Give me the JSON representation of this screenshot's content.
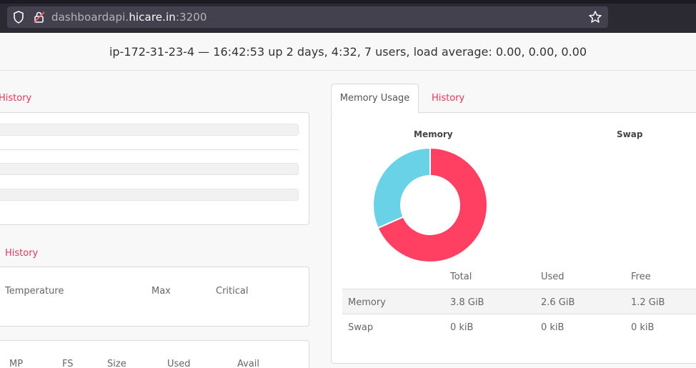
{
  "browser": {
    "url_host_prefix": "dashboardapi.",
    "url_host_main": "hicare.in",
    "url_port": ":3200"
  },
  "header": {
    "status_line": "ip-172-31-23-4 — 16:42:53 up 2 days, 4:32, 7 users, load average: 0.00, 0.00, 0.00"
  },
  "left": {
    "history_tab_1": "History",
    "history_tab_2": "History",
    "sensors_headers": [
      "Temperature",
      "Max",
      "Critical"
    ],
    "disk_headers": [
      "MP",
      "FS",
      "Size",
      "Used",
      "Avail"
    ]
  },
  "memory": {
    "tabs": [
      "Memory Usage",
      "History"
    ],
    "memory_chart_title": "Memory",
    "swap_chart_title": "Swap",
    "table_headers": [
      "",
      "Total",
      "Used",
      "Free"
    ],
    "rows": [
      {
        "label": "Memory",
        "total": "3.8 GiB",
        "used": "2.6 GiB",
        "free": "1.2 GiB"
      },
      {
        "label": "Swap",
        "total": "0 kiB",
        "used": "0 kiB",
        "free": "0 kiB"
      }
    ],
    "chart_data": {
      "type": "pie",
      "categories": [
        "Used",
        "Free"
      ],
      "values": [
        2.6,
        1.2
      ],
      "colors": [
        "#ff4063",
        "#69d2e7"
      ]
    }
  }
}
